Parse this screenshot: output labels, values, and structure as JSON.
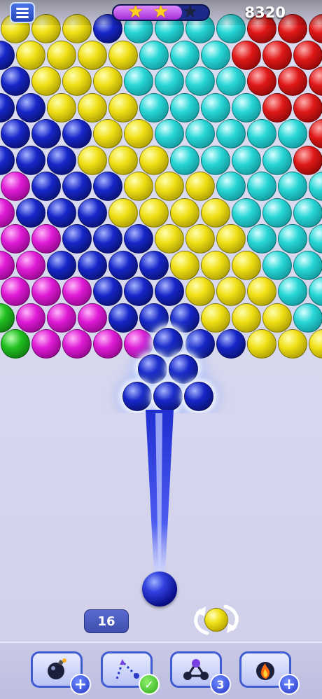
{
  "hud": {
    "score": "8320",
    "menu_icon": "hamburger-menu-icon",
    "stars_earned": 2,
    "stars_total": 3,
    "star_progress": 0.72
  },
  "colors": {
    "yellow": "#f0df14",
    "cyan": "#27d6d6",
    "red": "#e01818",
    "blue": "#1626c9",
    "magenta": "#e01ad6",
    "green": "#20c020",
    "aim_line": "#2a38d8"
  },
  "board": {
    "rows": [
      "yyybccccrrrrggr",
      "byyyycccrrrrg",
      "byyyccccrrrrg",
      "bbyyyccccrrrr",
      "bbbyycccccrrr",
      "bbbyyyccccrrr",
      "mbbbyyycccccr",
      "mbbbyyyycccc",
      "mmbbbyyycccc",
      "mmbbbbyyyccc",
      "mmmbbbyyyccc",
      "gmmmbbbyyycc",
      "gmmmmbbbyyyc"
    ],
    "glowing_cluster_count": 6
  },
  "shooter": {
    "current_ball": "blue",
    "next_ball": "yellow",
    "moves_left": "16",
    "swap_icon": "swap-arrows-icon"
  },
  "boosters": [
    {
      "name": "bomb",
      "icon": "bomb-icon",
      "badge": "+",
      "badge_type": "plus"
    },
    {
      "name": "aim-guide",
      "icon": "aim-guide-icon",
      "badge": "✓",
      "badge_type": "check"
    },
    {
      "name": "color-swap",
      "icon": "molecule-icon",
      "badge": "3",
      "badge_type": "count"
    },
    {
      "name": "fireball",
      "icon": "fire-icon",
      "badge": "+",
      "badge_type": "plus"
    }
  ]
}
